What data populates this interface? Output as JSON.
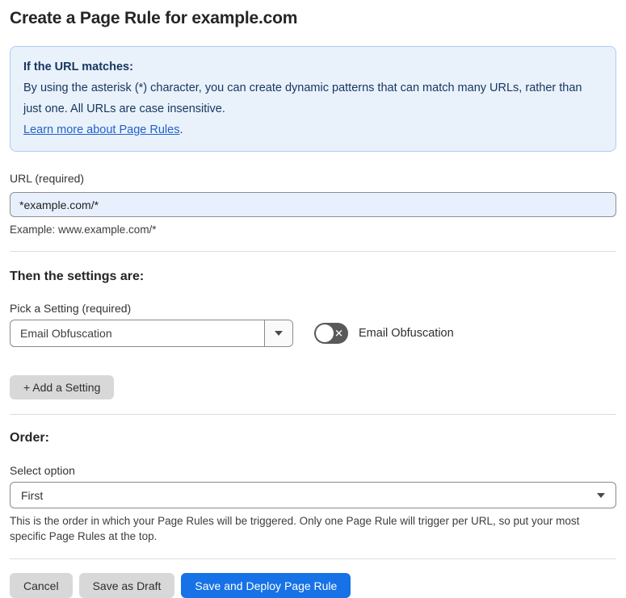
{
  "page": {
    "title": "Create a Page Rule for example.com"
  },
  "info_box": {
    "heading": "If the URL matches:",
    "body": "By using the asterisk (*) character, you can create dynamic patterns that can match many URLs, rather than just one. All URLs are case insensitive.",
    "link_label": "Learn more about Page Rules",
    "link_suffix": "."
  },
  "url_field": {
    "label": "URL (required)",
    "value": "*example.com/*",
    "helper": "Example: www.example.com/*"
  },
  "settings_section": {
    "heading": "Then the settings are:",
    "pick_setting_label": "Pick a Setting (required)",
    "selected_setting": "Email Obfuscation",
    "toggle_state": "off",
    "toggle_x_glyph": "✕",
    "toggle_label": "Email Obfuscation",
    "add_setting_label": "+ Add a Setting"
  },
  "order_section": {
    "heading": "Order:",
    "select_label": "Select option",
    "selected_option": "First",
    "helper": "This is the order in which your Page Rules will be triggered. Only one Page Rule will trigger per URL, so put your most specific Page Rules at the top."
  },
  "footer": {
    "cancel_label": "Cancel",
    "save_draft_label": "Save as Draft",
    "save_deploy_label": "Save and Deploy Page Rule"
  },
  "colors": {
    "primary_blue": "#1672e6",
    "info_bg": "#e9f1fb",
    "info_border": "#aecdf0",
    "info_text": "#16365f",
    "link_blue": "#2262c9",
    "input_autofill_bg": "#e8f0fe",
    "gray_button_bg": "#d8d8d8",
    "toggle_off_bg": "#595959"
  }
}
